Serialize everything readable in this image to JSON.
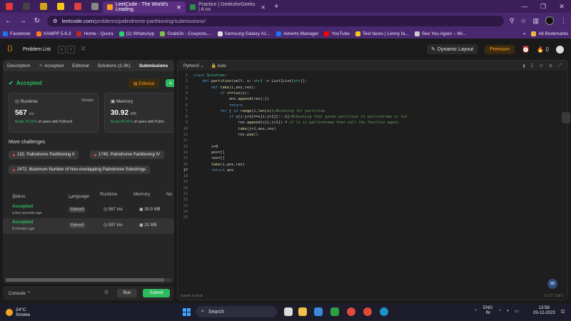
{
  "browser": {
    "active_tab_title": "LeetCode - The World's Leading",
    "inactive_tab_title": "Practice | GeeksforGeeks | A co",
    "url_host": "leetcode.com",
    "url_path": "/problems/palindrome-partitioning/submissions/"
  },
  "bookmarks": [
    "Facebook",
    "XAMPP 5.6.3",
    "Home - Quora",
    "(2) WhatsApp",
    "GrabOn - Coupons,...",
    "Samsung Galaxy A1...",
    "Adverts Manager",
    "YouTube",
    "Text faces | Lenny fa...",
    "See You Again – Wi..."
  ],
  "bookmarks_right": "All Bookmarks",
  "header": {
    "problem_list": "Problem List",
    "dynamic_layout": "Dynamic Layout",
    "premium": "Premium",
    "notif_count": "0"
  },
  "left": {
    "tabs": [
      "Description",
      "Accepted",
      "Editorial",
      "Solutions (3.3K)",
      "Submissions"
    ],
    "status": "Accepted",
    "editorial_btn": "Editorial",
    "runtime": {
      "label": "Runtime",
      "details": "Details",
      "value": "567",
      "unit": "ms",
      "beats_pct": "Beats 28.33%",
      "beats_rest": "of users with Python3"
    },
    "memory": {
      "label": "Memory",
      "value": "30.92",
      "unit": "MB",
      "beats_pct": "Beats 89.42%",
      "beats_rest": "of users with Pytho"
    },
    "more_challenges": "More challenges",
    "challenges": [
      "132. Palindrome Partitioning II",
      "1745. Palindrome Partitioning IV",
      "2472. Maximum Number of Non-overlapping Palindrome Substrings"
    ],
    "table_headers": [
      "Status",
      "Language",
      "Runtime",
      "Memory",
      "No"
    ],
    "rows": [
      {
        "status": "Accepted",
        "time": "a few seconds ago",
        "lang": "Python3",
        "runtime": "567 ms",
        "memory": "30.9 MB"
      },
      {
        "status": "Accepted",
        "time": "8 minutes ago",
        "lang": "Python3",
        "runtime": "597 ms",
        "memory": "31 MB"
      }
    ]
  },
  "console": {
    "label": "Console",
    "run": "Run",
    "submit": "Submit"
  },
  "editor": {
    "language": "Python3",
    "mode": "Auto",
    "saved": "Saved to local",
    "cursor": "Ln 17, Col 1"
  },
  "taskbar": {
    "temp": "24°C",
    "weather": "Smoke",
    "search": "Search",
    "lang_top": "ENG",
    "lang_bottom": "IN",
    "time": "13:58",
    "date": "03-12-2023"
  },
  "colors": {
    "accent": "#ffa116",
    "success": "#2cbb5d",
    "browser": "#4a2870"
  }
}
